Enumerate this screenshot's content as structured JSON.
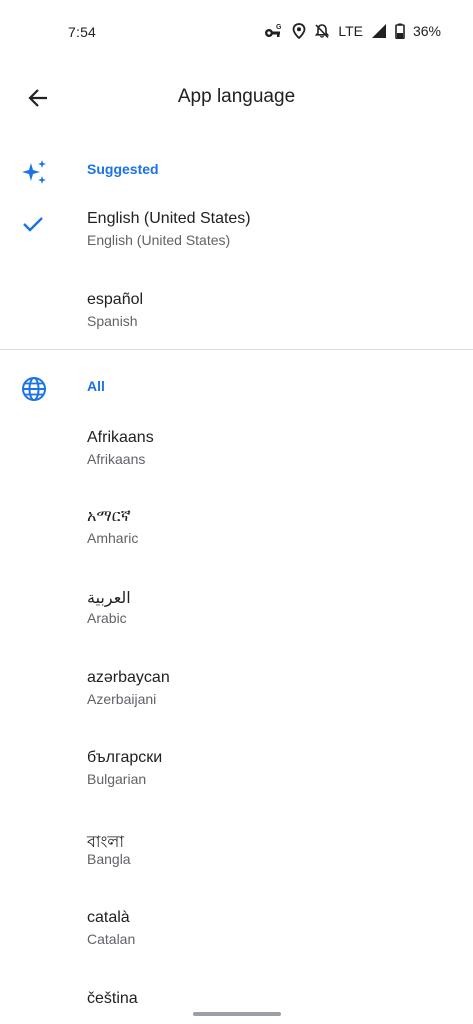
{
  "status_bar": {
    "time": "7:54",
    "network": "LTE",
    "battery": "36%",
    "icons": [
      "vpn-key-icon",
      "location-icon",
      "notifications-off-icon",
      "signal-icon",
      "battery-icon"
    ]
  },
  "header": {
    "title": "App language",
    "back_icon": "arrow-back-icon"
  },
  "suggested": {
    "label": "Suggested",
    "icon": "sparkle-icon",
    "items": [
      {
        "name": "English (United States)",
        "subtitle": "English (United States)",
        "selected": true
      },
      {
        "name": "español",
        "subtitle": "Spanish",
        "selected": false
      }
    ]
  },
  "all": {
    "label": "All",
    "icon": "globe-icon",
    "items": [
      {
        "name": "Afrikaans",
        "subtitle": "Afrikaans"
      },
      {
        "name": "አማርኛ",
        "subtitle": "Amharic"
      },
      {
        "name": "العربية",
        "subtitle": "Arabic"
      },
      {
        "name": "azərbaycan",
        "subtitle": "Azerbaijani"
      },
      {
        "name": "български",
        "subtitle": "Bulgarian"
      },
      {
        "name": "বাংলা",
        "subtitle": "Bangla"
      },
      {
        "name": "català",
        "subtitle": "Catalan"
      },
      {
        "name": "čeština",
        "subtitle": ""
      }
    ]
  },
  "colors": {
    "accent": "#1a73e8",
    "text_primary": "#202124",
    "text_secondary": "#5f6368",
    "divider": "#dadce0"
  }
}
